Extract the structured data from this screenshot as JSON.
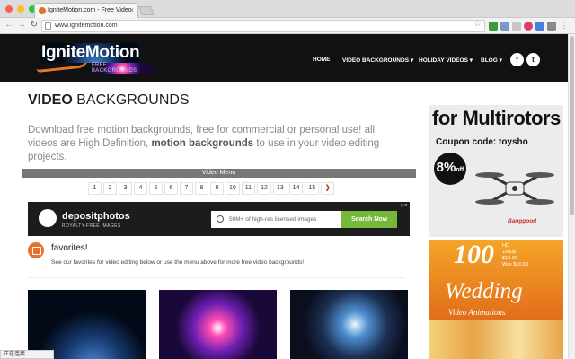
{
  "browser": {
    "tab_title": "IgniteMotion.com - Free Video",
    "address": "www.ignitemotion.com",
    "status_text": "正在连接..."
  },
  "site": {
    "logo_text": "IgniteMotion",
    "logo_tagline": "FREE BACKGROUNDS",
    "nav": {
      "home": "HOME",
      "video_backgrounds": "VIDEO BACKGROUNDS ▾",
      "holiday_videos": "HOLIDAY VIDEOS ▾",
      "blog": "BLOG ▾"
    },
    "social": {
      "facebook": "f",
      "twitter": "t"
    }
  },
  "main": {
    "title_bold": "VIDEO",
    "title_rest": " BACKGROUNDS",
    "intro_part1": "Download free motion backgrounds, free for commercial or personal use! all videos are High Definition, ",
    "intro_bold": "motion backgrounds",
    "intro_part2": " to use in your video editing projects.",
    "video_menu_label": "Video Menu",
    "pages": [
      "1",
      "2",
      "3",
      "4",
      "5",
      "6",
      "7",
      "8",
      "9",
      "10",
      "11",
      "12",
      "13",
      "14",
      "15"
    ],
    "next_label": "❯",
    "favorites_title": "favorites!",
    "favorites_desc": "See our favorites for video editing below or use the menu above for more free video backgrounds!"
  },
  "ad_banner": {
    "brand": "depositphotos",
    "tagline": "ROYALTY-FREE IMAGES",
    "search_placeholder": "50M+ of high-res licensed images",
    "search_button": "Search Now",
    "ad_choice": "▷✕"
  },
  "sidebar": {
    "ad1_headline": "for Multirotors",
    "ad1_code": "Coupon code: toysho",
    "ad1_badge": "8%",
    "ad1_badge_small": "off",
    "ad1_brand": "Banggood",
    "ad2_number": "100",
    "ad2_meta": [
      "HD",
      "1080p",
      "$10.00",
      "Was $10.00"
    ],
    "ad2_title": "Wedding",
    "ad2_subtitle": "Video Animations"
  },
  "colors": {
    "accent": "#e8702a",
    "header_bg": "#111111",
    "search_green": "#76b839"
  }
}
